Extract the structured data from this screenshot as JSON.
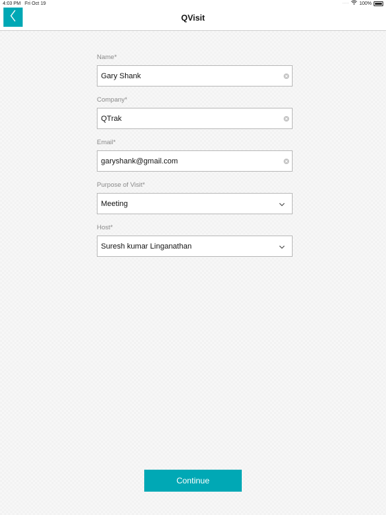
{
  "status_bar": {
    "time": "4:03 PM",
    "date": "Fri Oct 19",
    "battery": "100%"
  },
  "header": {
    "title": "QVisit"
  },
  "form": {
    "name": {
      "label": "Name*",
      "value": "Gary Shank"
    },
    "company": {
      "label": "Company*",
      "value": "QTrak"
    },
    "email": {
      "label": "Email*",
      "value": "garyshank@gmail.com"
    },
    "purpose": {
      "label": "Purpose of Visit*",
      "value": "Meeting"
    },
    "host": {
      "label": "Host*",
      "value": "Suresh kumar Linganathan"
    }
  },
  "actions": {
    "continue_label": "Continue"
  },
  "colors": {
    "accent": "#00a8b5"
  }
}
